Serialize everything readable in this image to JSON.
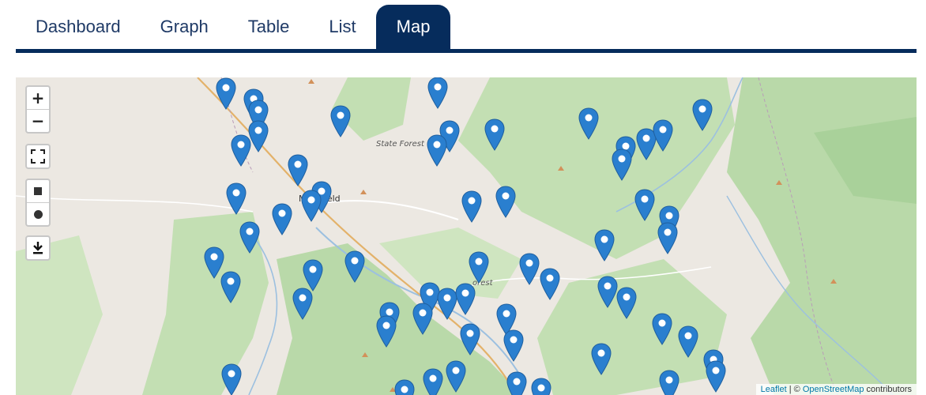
{
  "tabs": [
    {
      "label": "Dashboard",
      "active": false
    },
    {
      "label": "Graph",
      "active": false
    },
    {
      "label": "Table",
      "active": false
    },
    {
      "label": "List",
      "active": false
    },
    {
      "label": "Map",
      "active": true
    }
  ],
  "colors": {
    "accent": "#062c5c",
    "forest": "#b9d9a9",
    "land": "#ece8e2",
    "marker": "#2a7fcf",
    "water": "#aac8e6",
    "road": "#e3b26a"
  },
  "map_controls": {
    "zoom_in": "+",
    "zoom_out": "−",
    "fullscreen_icon": "fullscreen-icon",
    "draw_rectangle_icon": "square-icon",
    "draw_circle_icon": "circle-icon",
    "download_icon": "download-icon"
  },
  "map_labels": {
    "town": "Mansfield",
    "state_forest": "State Forest",
    "forest_fragment": "orest",
    "road_number": "350"
  },
  "attribution": {
    "leaflet": "Leaflet",
    "separator": " | © ",
    "osm": "OpenStreetMap",
    "suffix": " contributors"
  },
  "marker_count": 55
}
